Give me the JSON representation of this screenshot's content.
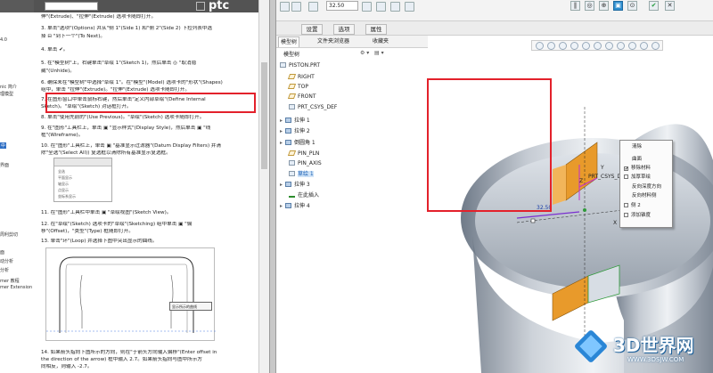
{
  "doc": {
    "logo": "ptc",
    "lines": [
      "伸\"(Extrude)、\"拉伸\"(Extrude) 选项卡随即打开。",
      "3. 单击\"选项\"(Options) 并从\"侧 1\"(Side 1) 和\"侧 2\"(Side 2) 下拉列表中选",
      "   择 ⊟ \"到下一个\"(To Next)。",
      "4. 单击 ✔。",
      "5. 在\"模型树\"上，右键单击\"草绘 1\"(Sketch 1)，然后单击 ◎ \"取消隐",
      "   藏\"(Unhide)。",
      "6. 确保未在\"模型树\"中选择\"草绘 1\"。在\"模型\"(Model) 选项卡的\"形状\"(Shapes)",
      "   组中，单击 \"拉伸\"(Extrude)。\"拉伸\"(Extrude) 选项卡随即打开。",
      "7. 在图形窗口中单击鼠标右键，然后单击\"定义内部草绘\"(Define Internal",
      "   Sketch)。\"草绘\"(Sketch) 对话框打开。",
      "8. 单击\"使用先前的\"(Use Previous)。\"草绘\"(Sketch) 选项卡随即打开。",
      "9. 在\"图形\"工具栏上，单击 ▣ \"显示样式\"(Display Style)，然后单击 ▣ \"线",
      "   框\"(Wireframe)。",
      "10. 在\"图形\"工具栏上，单击 ▣ \"基准显示过滤器\"(Datum Display Filters) 并清",
      "    除\"全选\"(Select All)) 复选框以清除所有基准显示复选框。",
      "11. 在\"图形\"工具栏中单击 ▣ \"草绘视图\"(Sketch View)。",
      "12. 在\"草绘\"(Sketch) 选项卡的\"草绘\"(Sketching) 组中单击 ▣ \"偏",
      "    移\"(Offset)，\"类型\"(Type) 框随即打开。",
      "13. 单击\"环\"(Loop) 并选择下图中突出显示的曲线。",
      "14. 如果箭头指向下图所示的方向，则在\"于箭头方向输入偏移\"(Enter offset in",
      "    the direction of the arrow) 框中输入 2.7。如果箭头指向与图中所示方",
      "    向相反，则输入 -2.7。"
    ],
    "thumb1_rows": [
      "全选",
      "平面显示",
      "轴显示",
      "点显示",
      "坐标系显示"
    ],
    "thumb2_tip": "显示所示的曲线"
  },
  "toc": {
    "items": [
      "4.0",
      "nic 简介",
      "理模型",
      "中",
      "界面",
      "周利剪切",
      "面",
      "动分析",
      "分析",
      "mer 教程",
      "mer Extension"
    ],
    "highlighted": "中"
  },
  "creo": {
    "zoom_value": "32.50",
    "subtabs": [
      "设置",
      "选项",
      "属性"
    ],
    "tree_tabs": [
      "模型树",
      "文件夹浏览器",
      "收藏夹"
    ],
    "tree_header": "模型树",
    "tree_items": [
      {
        "label": "PISTON.PRT",
        "icon": "part-icon",
        "twisty": ""
      },
      {
        "label": "RIGHT",
        "icon": "plane-icon",
        "twisty": ""
      },
      {
        "label": "TOP",
        "icon": "plane-icon",
        "twisty": ""
      },
      {
        "label": "FRONT",
        "icon": "plane-icon",
        "twisty": ""
      },
      {
        "label": "PRT_CSYS_DEF",
        "icon": "csys-icon",
        "twisty": ""
      },
      {
        "label": "拉伸 1",
        "icon": "extrude-icon",
        "twisty": "▸"
      },
      {
        "label": "拉伸 2",
        "icon": "extrude-icon",
        "twisty": "▸"
      },
      {
        "label": "倒圆角 1",
        "icon": "round-icon",
        "twisty": "▸"
      },
      {
        "label": "PIN_PLN",
        "icon": "plane-icon",
        "twisty": ""
      },
      {
        "label": "PIN_AXIS",
        "icon": "axis-icon",
        "twisty": ""
      },
      {
        "label": "草绘 1",
        "icon": "sketch-icon",
        "twisty": ""
      },
      {
        "label": "拉伸 3",
        "icon": "extrude-icon",
        "twisty": "▸"
      },
      {
        "label": "在此插入",
        "icon": "insert-icon",
        "twisty": ""
      },
      {
        "label": "拉伸 4",
        "icon": "extrude-icon",
        "twisty": "▸"
      }
    ],
    "context_menu": [
      {
        "label": "清除",
        "checkbox": false,
        "checked": false
      },
      {
        "label": "曲面",
        "checkbox": false,
        "checked": false
      },
      {
        "label": "移除材料",
        "checkbox": true,
        "checked": true
      },
      {
        "label": "加厚草绘",
        "checkbox": true,
        "checked": false
      },
      {
        "label": "反向深度方向",
        "checkbox": false,
        "checked": false
      },
      {
        "label": "反向材料侧",
        "checkbox": false,
        "checked": false
      },
      {
        "label": "侧 2",
        "checkbox": true,
        "checked": false
      },
      {
        "label": "添加锥度",
        "checkbox": true,
        "checked": false
      }
    ],
    "model_labels": {
      "csys": "PRT_CSYS_DEF",
      "dim": "32.50",
      "x": "X",
      "y": "Y",
      "z": "Z"
    },
    "colors": {
      "highlight": "#e3212b",
      "accent": "#2f8fd0",
      "feature": "#e89a2b",
      "datum": "#c12fd0"
    }
  },
  "watermark": {
    "title": "3D世界网",
    "url": "WWW.3DSJW.COM"
  }
}
